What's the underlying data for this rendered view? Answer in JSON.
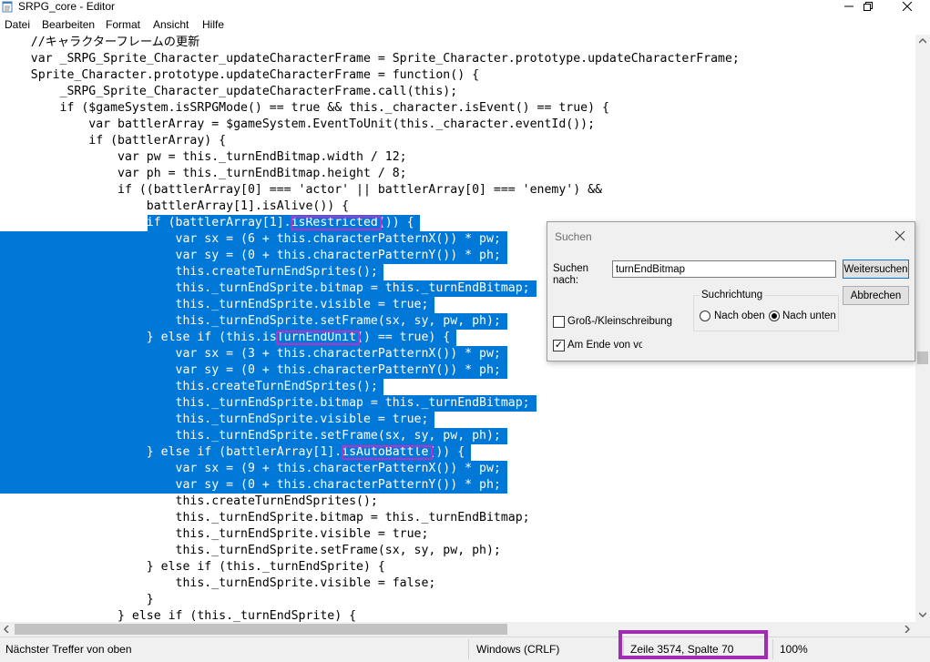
{
  "window": {
    "title": "SRPG_core - Editor"
  },
  "menu": [
    "Datei",
    "Bearbeiten",
    "Format",
    "Ansicht",
    "Hilfe"
  ],
  "code_lines": [
    "    //キャラクターフレームの更新",
    "    var _SRPG_Sprite_Character_updateCharacterFrame = Sprite_Character.prototype.updateCharacterFrame;",
    "    Sprite_Character.prototype.updateCharacterFrame = function() {",
    "        _SRPG_Sprite_Character_updateCharacterFrame.call(this);",
    "        if ($gameSystem.isSRPGMode() == true && this._character.isEvent() == true) {",
    "            var battlerArray = $gameSystem.EventToUnit(this._character.eventId());",
    "            if (battlerArray) {",
    "                var pw = this._turnEndBitmap.width / 12;",
    "                var ph = this._turnEndBitmap.height / 8;",
    "                if ((battlerArray[0] === 'actor' || battlerArray[0] === 'enemy') &&",
    "                    battlerArray[1].isAlive()) {",
    "                    if (battlerArray[1].isRestricted()) {",
    "                        var sx = (6 + this.characterPatternX()) * pw;",
    "                        var sy = (0 + this.characterPatternY()) * ph;",
    "                        this.createTurnEndSprites();",
    "                        this._turnEndSprite.bitmap = this._turnEndBitmap;",
    "                        this._turnEndSprite.visible = true;",
    "                        this._turnEndSprite.setFrame(sx, sy, pw, ph);",
    "                    } else if (this.isTurnEndUnit() == true) {",
    "                        var sx = (3 + this.characterPatternX()) * pw;",
    "                        var sy = (0 + this.characterPatternY()) * ph;",
    "                        this.createTurnEndSprites();",
    "                        this._turnEndSprite.bitmap = this._turnEndBitmap;",
    "                        this._turnEndSprite.visible = true;",
    "                        this._turnEndSprite.setFrame(sx, sy, pw, ph);",
    "                    } else if (battlerArray[1].isAutoBattle()) {",
    "                        var sx = (9 + this.characterPatternX()) * pw;",
    "                        var sy = (0 + this.characterPatternY()) * ph;",
    "                        this.createTurnEndSprites();",
    "                        this._turnEndSprite.bitmap = this._turnEndBitmap;",
    "                        this._turnEndSprite.visible = true;",
    "                        this._turnEndSprite.setFrame(sx, sy, pw, ph);",
    "                    } else if (this._turnEndSprite) {",
    "                        this._turnEndSprite.visible = false;",
    "                    }",
    "                } else if (this._turnEndSprite) {"
  ],
  "selection": {
    "first_line": 11,
    "last_line": 27
  },
  "highlights": [
    {
      "line": 11,
      "text": "isRestricted"
    },
    {
      "line": 18,
      "text": "TurnEndUnit"
    },
    {
      "line": 25,
      "text": "isAutoBattle"
    }
  ],
  "status": {
    "message": "Nächster Treffer von oben",
    "line_ending": "Windows (CRLF)",
    "position": "Zeile 3574, Spalte 70",
    "zoom": "100%"
  },
  "find_dialog": {
    "title": "Suchen",
    "search_label": "Suchen nach:",
    "search_value": "turnEndBitmap",
    "find_next_label": "Weitersuchen",
    "cancel_label": "Abbrechen",
    "direction_label": "Suchrichtung",
    "up_label": "Nach oben",
    "down_label": "Nach unten",
    "direction_selected": "down",
    "match_case_label": "Groß-/Kleinschreibung",
    "match_case": false,
    "wrap_label": "Am Ende von vorn",
    "wrap": true
  },
  "colors": {
    "selection": "#0078d7",
    "highlight_box": "#c02cc8",
    "status_box": "#a02db4"
  }
}
